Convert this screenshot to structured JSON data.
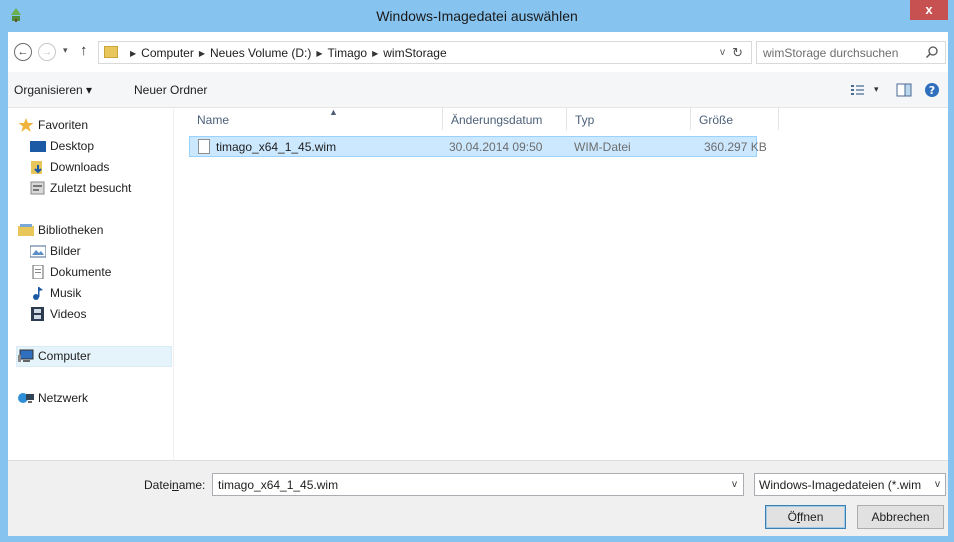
{
  "window": {
    "title": "Windows-Imagedatei auswählen",
    "close_glyph": "x",
    "accent": "#86c3ef"
  },
  "address": {
    "back_glyph": "←",
    "forward_glyph": "→",
    "history_glyph": "▾",
    "up_glyph": "↑",
    "breadcrumbs": [
      "Computer",
      "Neues Volume (D:)",
      "Timago",
      "wimStorage"
    ],
    "separator_glyph": "▶",
    "dropdown_glyph": "v",
    "refresh_glyph": "↻"
  },
  "search": {
    "placeholder": "wimStorage durchsuchen"
  },
  "toolbar": {
    "organize_label": "Organisieren ▾",
    "new_folder_label": "Neuer Ordner",
    "view_dropdown_glyph": "▾"
  },
  "navigation": {
    "favorites_label": "Favoriten",
    "favorites_items": [
      "Desktop",
      "Downloads",
      "Zuletzt besucht"
    ],
    "libraries_label": "Bibliotheken",
    "libraries_items": [
      "Bilder",
      "Dokumente",
      "Musik",
      "Videos"
    ],
    "computer_label": "Computer",
    "network_label": "Netzwerk",
    "selected": "Computer"
  },
  "file_list": {
    "sort_glyph": "▲",
    "columns": [
      "Name",
      "Änderungsdatum",
      "Typ",
      "Größe"
    ],
    "rows": [
      {
        "name": "timago_x64_1_45.wim",
        "modified": "30.04.2014 09:50",
        "type": "WIM-Datei",
        "size": "360.297 KB",
        "selected": true
      }
    ],
    "selection_color": "#cce8ff"
  },
  "footer": {
    "filename_label_prefix": "Datei",
    "filename_label_underlined": "n",
    "filename_label_suffix": "ame:",
    "filename_value": "timago_x64_1_45.wim",
    "filter_value": "Windows-Imagedateien (*.wim",
    "dropdown_glyph": "v",
    "open_button_prefix": "Ö",
    "open_button_underlined": "f",
    "open_button_suffix": "fnen",
    "cancel_button": "Abbrechen"
  }
}
